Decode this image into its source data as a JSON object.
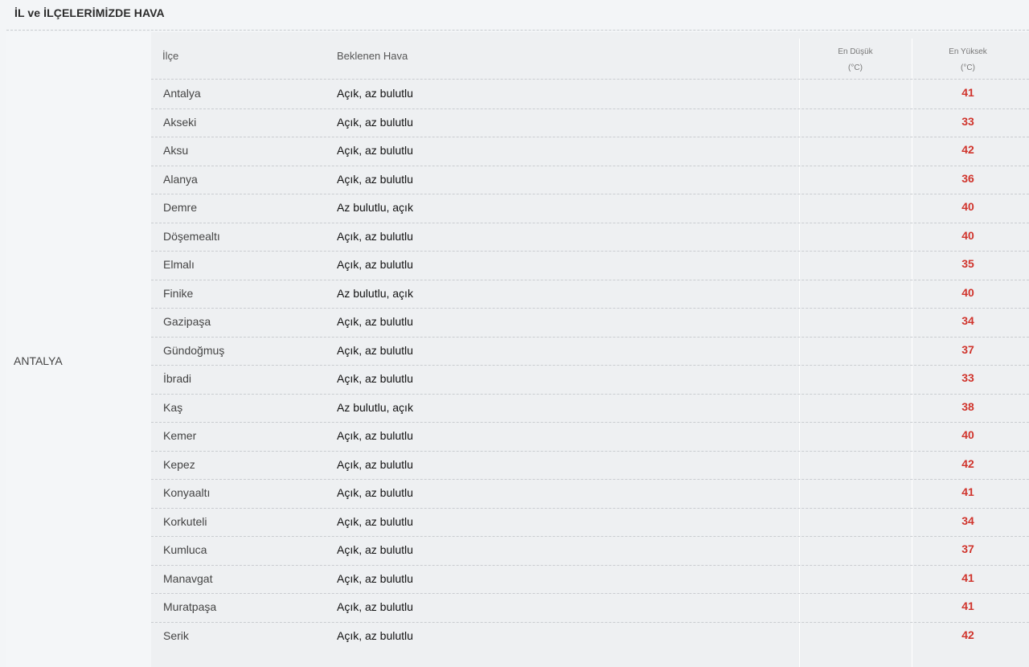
{
  "section": {
    "title": "İL ve İLÇELERİMİZDE HAVA"
  },
  "province": {
    "name": "ANTALYA"
  },
  "table": {
    "headers": {
      "district": "İlçe",
      "forecast": "Beklenen Hava",
      "min_line1": "En Düşük",
      "min_line2": "(°C)",
      "max_line1": "En Yüksek",
      "max_line2": "(°C)"
    },
    "rows": [
      {
        "district": "Antalya",
        "forecast": "Açık, az bulutlu",
        "min": "",
        "max": "41"
      },
      {
        "district": "Akseki",
        "forecast": "Açık, az bulutlu",
        "min": "",
        "max": "33"
      },
      {
        "district": "Aksu",
        "forecast": "Açık, az bulutlu",
        "min": "",
        "max": "42"
      },
      {
        "district": "Alanya",
        "forecast": "Açık, az bulutlu",
        "min": "",
        "max": "36"
      },
      {
        "district": "Demre",
        "forecast": "Az bulutlu, açık",
        "min": "",
        "max": "40"
      },
      {
        "district": "Döşemealtı",
        "forecast": "Açık, az bulutlu",
        "min": "",
        "max": "40"
      },
      {
        "district": "Elmalı",
        "forecast": "Açık, az bulutlu",
        "min": "",
        "max": "35"
      },
      {
        "district": "Finike",
        "forecast": "Az bulutlu, açık",
        "min": "",
        "max": "40"
      },
      {
        "district": "Gazipaşa",
        "forecast": "Açık, az bulutlu",
        "min": "",
        "max": "34"
      },
      {
        "district": "Gündoğmuş",
        "forecast": "Açık, az bulutlu",
        "min": "",
        "max": "37"
      },
      {
        "district": "İbradi",
        "forecast": "Açık, az bulutlu",
        "min": "",
        "max": "33"
      },
      {
        "district": "Kaş",
        "forecast": "Az bulutlu, açık",
        "min": "",
        "max": "38"
      },
      {
        "district": "Kemer",
        "forecast": "Açık, az bulutlu",
        "min": "",
        "max": "40"
      },
      {
        "district": "Kepez",
        "forecast": "Açık, az bulutlu",
        "min": "",
        "max": "42"
      },
      {
        "district": "Konyaaltı",
        "forecast": "Açık, az bulutlu",
        "min": "",
        "max": "41"
      },
      {
        "district": "Korkuteli",
        "forecast": "Açık, az bulutlu",
        "min": "",
        "max": "34"
      },
      {
        "district": "Kumluca",
        "forecast": "Açık, az bulutlu",
        "min": "",
        "max": "37"
      },
      {
        "district": "Manavgat",
        "forecast": "Açık, az bulutlu",
        "min": "",
        "max": "41"
      },
      {
        "district": "Muratpaşa",
        "forecast": "Açık, az bulutlu",
        "min": "",
        "max": "41"
      },
      {
        "district": "Serik",
        "forecast": "Açık, az bulutlu",
        "min": "",
        "max": "42"
      }
    ]
  },
  "colors": {
    "max_temp": "#d0342c",
    "background": "#f3f5f7"
  }
}
